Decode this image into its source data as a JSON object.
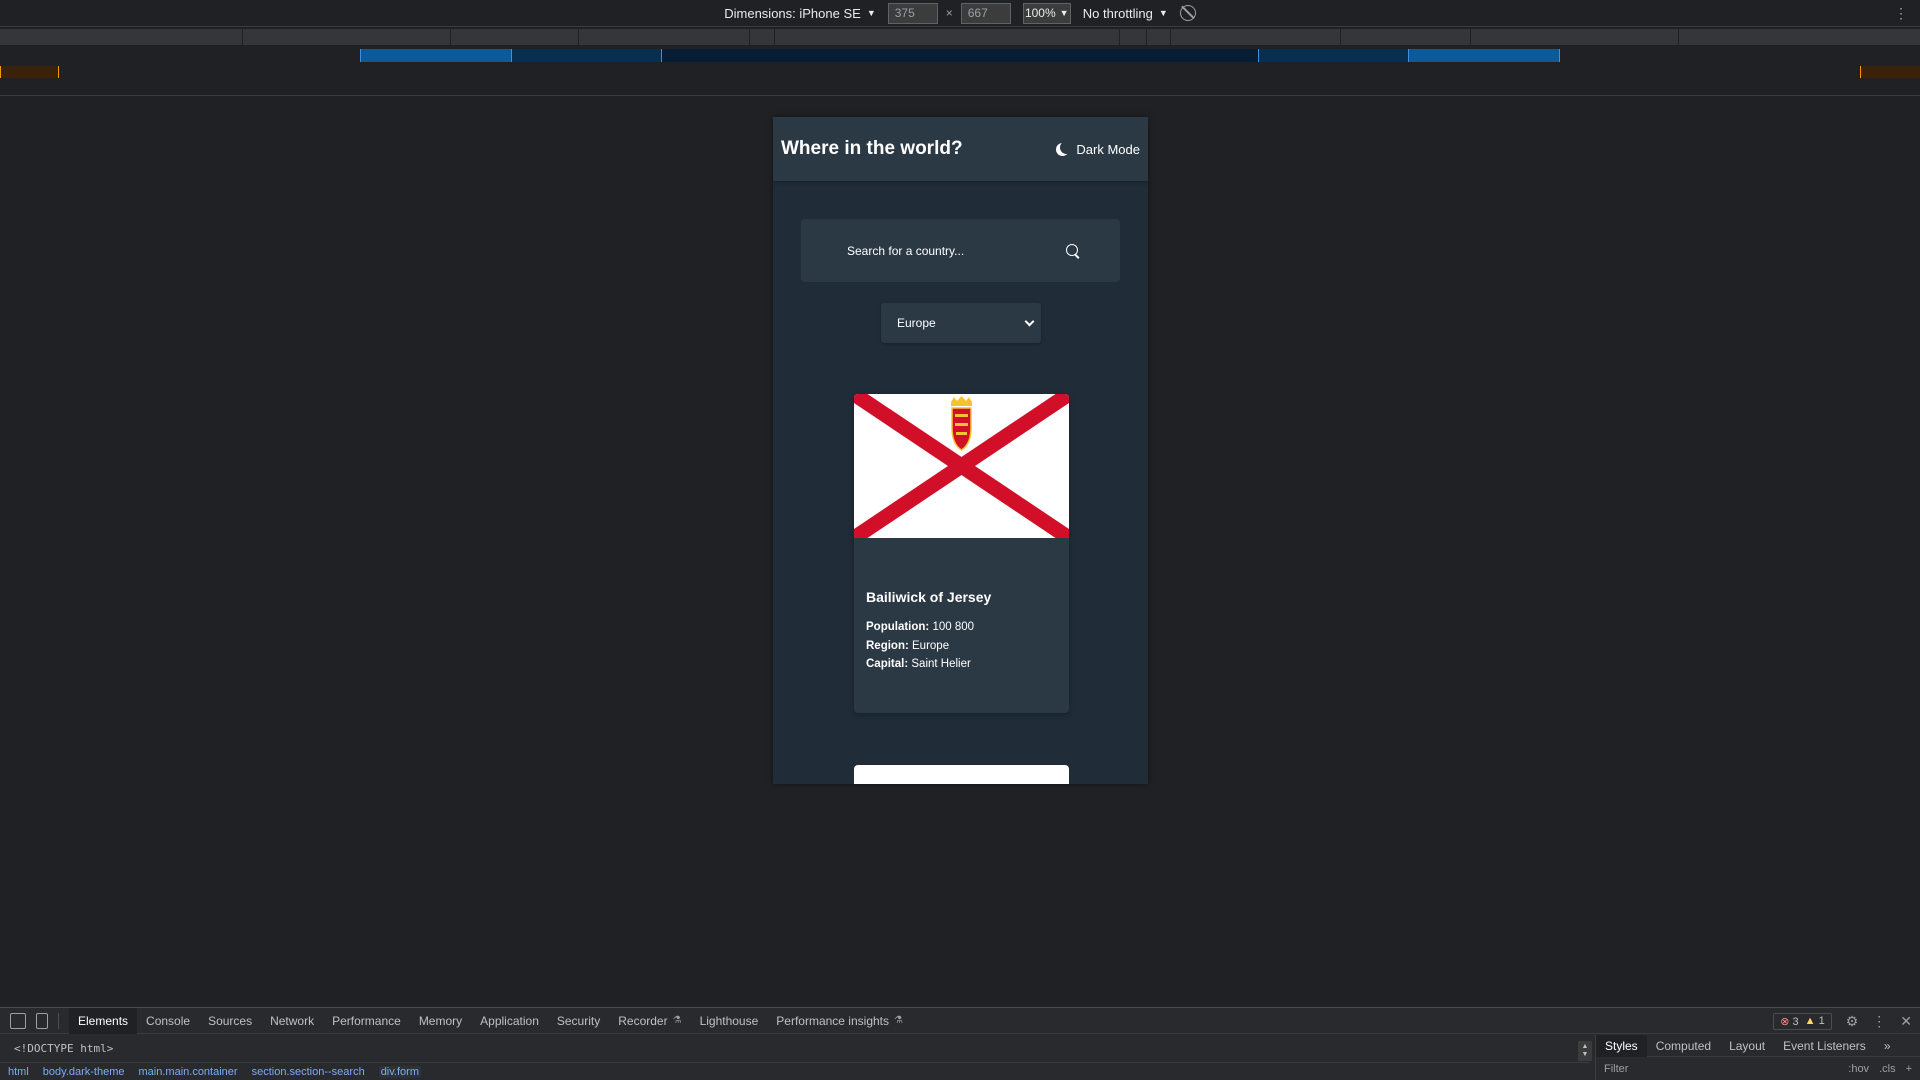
{
  "device_toolbar": {
    "dimensions_label": "Dimensions: iPhone SE",
    "width_value": "375",
    "height_value": "667",
    "times_sign": "×",
    "zoom": "100%",
    "throttling": "No throttling"
  },
  "app": {
    "title": "Where in the world?",
    "theme_toggle_label": "Dark Mode",
    "search_placeholder": "Search for a country...",
    "region_selected": "Europe",
    "card": {
      "name": "Bailiwick of Jersey",
      "population_label": "Population:",
      "population_value": "100 800",
      "region_label": "Region:",
      "region_value": "Europe",
      "capital_label": "Capital:",
      "capital_value": "Saint Helier"
    },
    "colors": {
      "background": "#202c37",
      "element": "#2b3945",
      "text": "#ffffff",
      "flag_red": "#d20f29"
    }
  },
  "devtools": {
    "tabs": [
      {
        "label": "Elements",
        "experimental": false
      },
      {
        "label": "Console",
        "experimental": false
      },
      {
        "label": "Sources",
        "experimental": false
      },
      {
        "label": "Network",
        "experimental": false
      },
      {
        "label": "Performance",
        "experimental": false
      },
      {
        "label": "Memory",
        "experimental": false
      },
      {
        "label": "Application",
        "experimental": false
      },
      {
        "label": "Security",
        "experimental": false
      },
      {
        "label": "Recorder",
        "experimental": true
      },
      {
        "label": "Lighthouse",
        "experimental": false
      },
      {
        "label": "Performance insights",
        "experimental": true
      }
    ],
    "active_tab": "Elements",
    "error_count": "3",
    "warning_count": "1",
    "doctype_line": "<!DOCTYPE html>",
    "breadcrumbs": [
      "html",
      "body.dark-theme",
      "main.main.container",
      "section.section--search",
      "div.form"
    ],
    "side_tabs": [
      "Styles",
      "Computed",
      "Layout",
      "Event Listeners"
    ],
    "side_more": "»",
    "filter_placeholder": "Filter",
    "hov_label": ":hov",
    "cls_label": ".cls"
  }
}
